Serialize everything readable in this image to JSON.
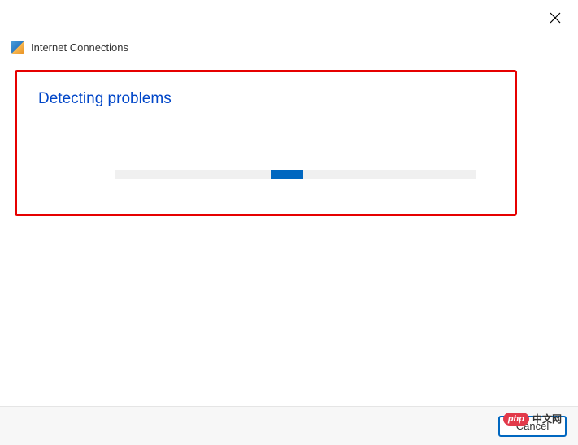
{
  "header": {
    "title": "Internet Connections"
  },
  "content": {
    "status": "Detecting problems"
  },
  "footer": {
    "cancel_label": "Cancel"
  },
  "watermark": {
    "badge": "php",
    "text": "中文网"
  }
}
